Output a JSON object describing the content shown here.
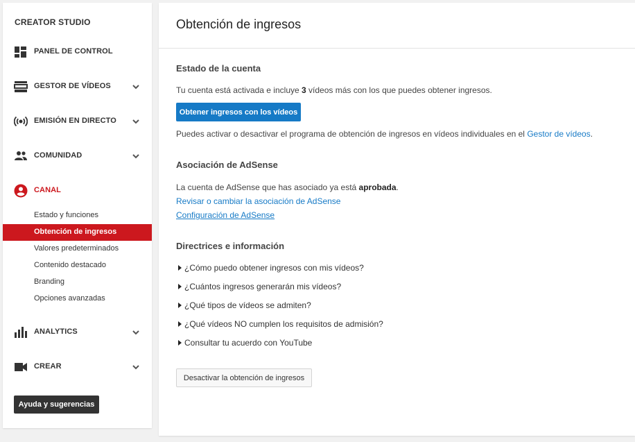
{
  "sidebar": {
    "title": "CREATOR STUDIO",
    "items": [
      {
        "label": "PANEL DE CONTROL",
        "icon": "dashboard-icon"
      },
      {
        "label": "GESTOR DE VÍDEOS",
        "icon": "video-manager-icon"
      },
      {
        "label": "EMISIÓN EN DIRECTO",
        "icon": "live-broadcast-icon"
      },
      {
        "label": "COMUNIDAD",
        "icon": "community-icon"
      },
      {
        "label": "CANAL",
        "icon": "channel-icon"
      },
      {
        "label": "ANALYTICS",
        "icon": "analytics-icon"
      },
      {
        "label": "CREAR",
        "icon": "create-icon"
      }
    ],
    "channel_subitems": [
      "Estado y funciones",
      "Obtención de ingresos",
      "Valores predeterminados",
      "Contenido destacado",
      "Branding",
      "Opciones avanzadas"
    ],
    "help_button": "Ayuda y sugerencias"
  },
  "main": {
    "title": "Obtención de ingresos",
    "account_status": {
      "heading": "Estado de la cuenta",
      "text_before": "Tu cuenta está activada e incluye ",
      "count": "3",
      "text_after": " vídeos más con los que puedes obtener ingresos.",
      "button": "Obtener ingresos con los vídeos",
      "note_before": "Puedes activar o desactivar el programa de obtención de ingresos en vídeos individuales en el ",
      "note_link": "Gestor de vídeos",
      "note_after": "."
    },
    "adsense": {
      "heading": "Asociación de AdSense",
      "text_before": "La cuenta de AdSense que has asociado ya está ",
      "status": "aprobada",
      "text_after": ".",
      "link_review": "Revisar o cambiar la asociación de AdSense",
      "link_config": "Configuración de AdSense"
    },
    "guidelines": {
      "heading": "Directrices e información",
      "items": [
        "¿Cómo puedo obtener ingresos con mis vídeos?",
        "¿Cuántos ingresos generarán mis vídeos?",
        "¿Qué tipos de vídeos se admiten?",
        "¿Qué vídeos NO cumplen los requisitos de admisión?",
        "Consultar tu acuerdo con YouTube"
      ]
    },
    "deactivate_button": "Desactivar la obtención de ingresos"
  },
  "colors": {
    "accent_red": "#cc181e",
    "link_blue": "#167ac6",
    "dark_button": "#333333"
  }
}
